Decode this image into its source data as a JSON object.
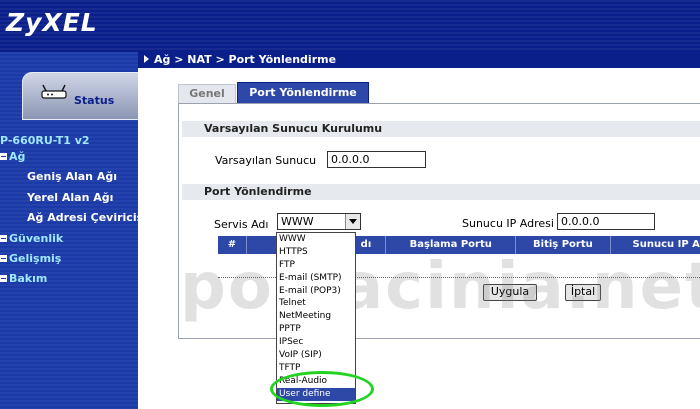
{
  "brand": {
    "logo": "ZyXEL"
  },
  "breadcrumb": {
    "text": "Ağ > NAT > Port Yönlendirme"
  },
  "sidebar": {
    "status_tab": "Status",
    "device": "P-660RU-T1 v2",
    "items": [
      {
        "label": "Ağ",
        "kind": "group"
      },
      {
        "label": "Geniş Alan Ağı",
        "kind": "sub"
      },
      {
        "label": "Yerel Alan Ağı",
        "kind": "sub"
      },
      {
        "label": "Ağ Adresi Çeviricis",
        "kind": "sub"
      },
      {
        "label": "Güvenlik",
        "kind": "group"
      },
      {
        "label": "Gelişmiş",
        "kind": "group"
      },
      {
        "label": "Bakım",
        "kind": "group"
      }
    ]
  },
  "tabs": [
    {
      "label": "Genel",
      "active": false
    },
    {
      "label": "Port Yönlendirme",
      "active": true
    }
  ],
  "default_server": {
    "section_title": "Varsayılan Sunucu Kurulumu",
    "field_label": "Varsayılan Sunucu",
    "value": "0.0.0.0"
  },
  "port_forwarding": {
    "section_title": "Port Yönlendirme",
    "service_label": "Servis Adı",
    "service_selected": "WWW",
    "server_ip_label": "Sunucu IP Adresi",
    "server_ip_value": "0.0.0.0",
    "table_headers": [
      "#",
      "Akt",
      "dı",
      "Başlama Portu",
      "Bitiş Portu",
      "Sunucu IP A"
    ],
    "service_options": [
      "WWW",
      "HTTPS",
      "FTP",
      "E-mail (SMTP)",
      "E-mail (POP3)",
      "Telnet",
      "NetMeeting",
      "PPTP",
      "IPSec",
      "VoIP (SIP)",
      "TFTP",
      "Real-Audio",
      "User define"
    ],
    "highlighted_option": "User define"
  },
  "buttons": {
    "apply": "Uygula",
    "cancel": "İptal"
  },
  "watermark": "portacinia.net",
  "colors": {
    "header_blue": "#0a1f8a",
    "tab_blue": "#2e48a8",
    "highlight_ring": "#22d322"
  }
}
